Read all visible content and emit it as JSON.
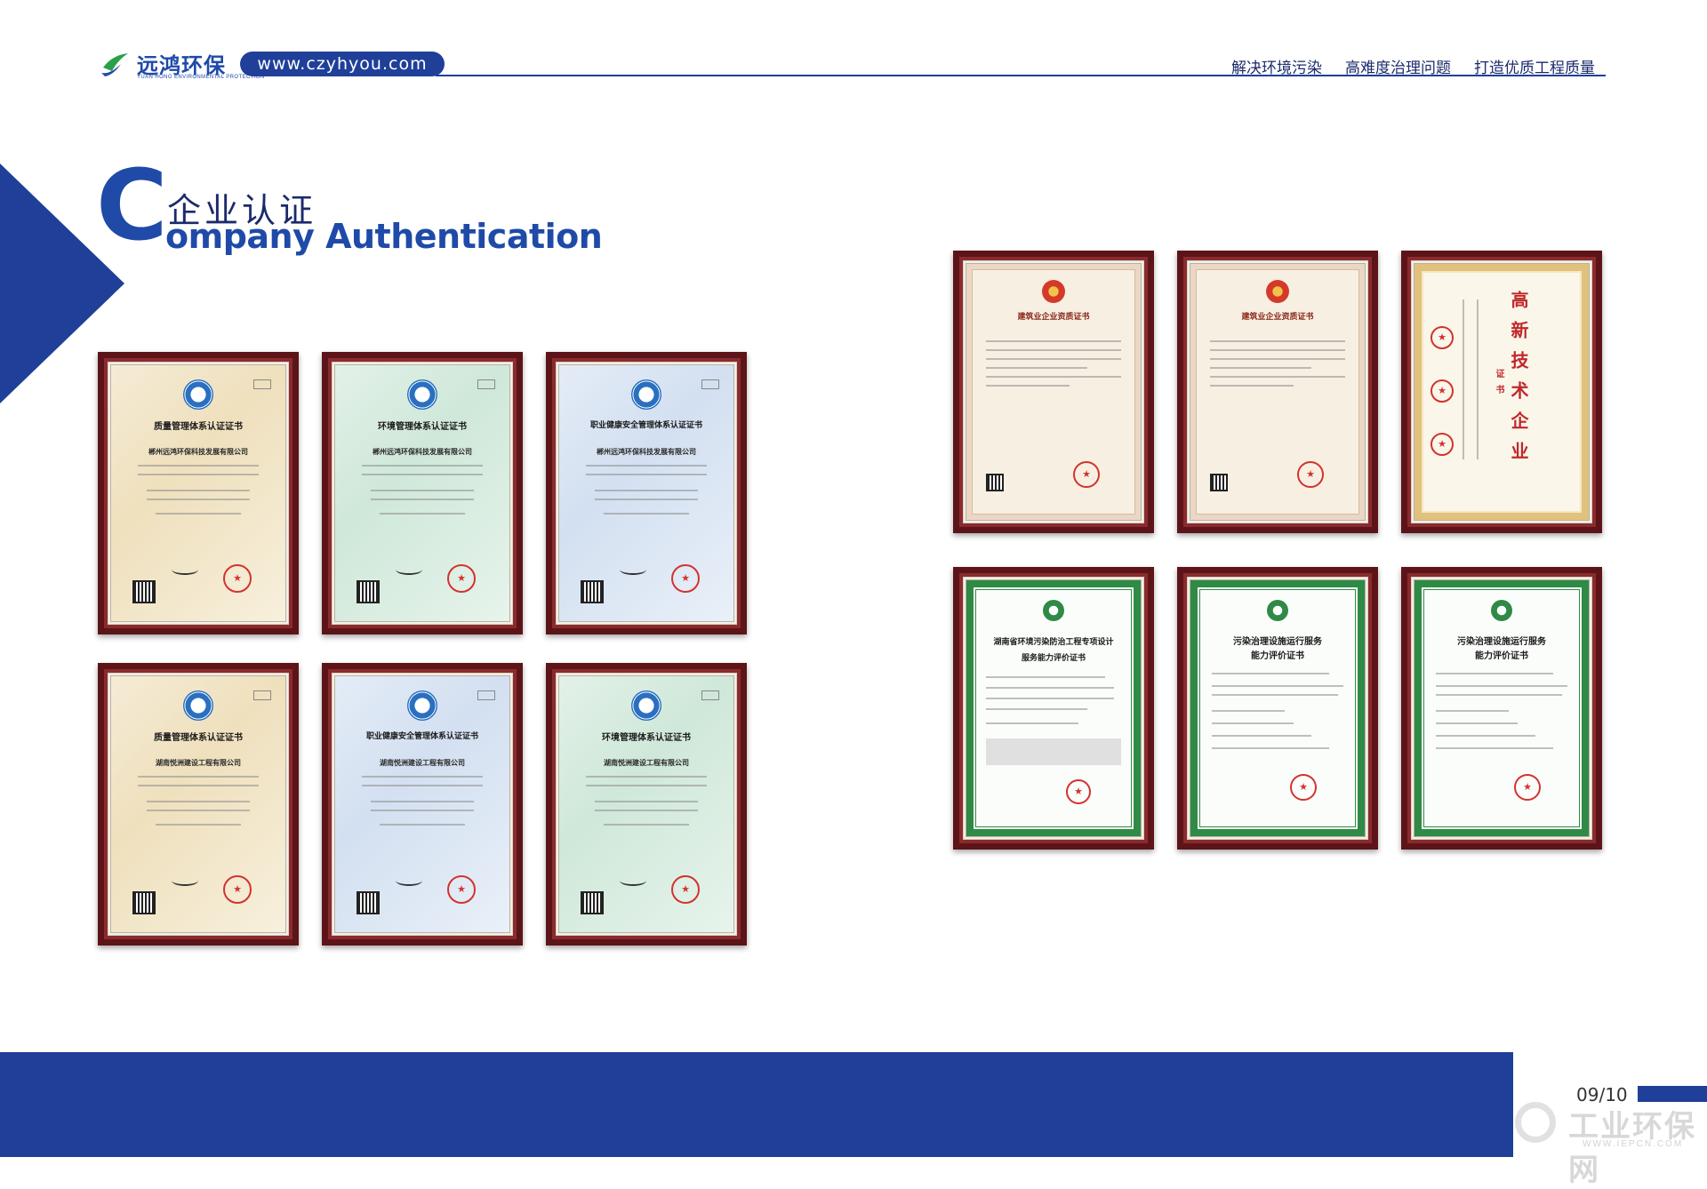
{
  "header": {
    "logo": {
      "cn": "远鸿环保",
      "en": "YUAN HONG ENVIRONMENTAL PROTECTION"
    },
    "url": "www.czyhyou.com",
    "slogans": [
      "解决环境污染",
      "高难度治理问题",
      "打造优质工程质量"
    ]
  },
  "section": {
    "initial": "C",
    "title_cn": "企业认证",
    "title_en": "ompany Authentication"
  },
  "certificates": {
    "iso_row1": [
      {
        "title": "质量管理体系认证证书",
        "company": "郴州远鸿环保科技发展有限公司"
      },
      {
        "title": "环境管理体系认证证书",
        "company": "郴州远鸿环保科技发展有限公司"
      },
      {
        "title": "职业健康安全管理体系认证证书",
        "company": "郴州远鸿环保科技发展有限公司"
      }
    ],
    "iso_row2": [
      {
        "title": "质量管理体系认证证书",
        "company": "湖南悦洲建设工程有限公司"
      },
      {
        "title": "职业健康安全管理体系认证证书",
        "company": "湖南悦洲建设工程有限公司"
      },
      {
        "title": "环境管理体系认证证书",
        "company": "湖南悦洲建设工程有限公司"
      }
    ],
    "qualification": [
      {
        "title": "建筑业企业资质证书"
      },
      {
        "title": "建筑业企业资质证书"
      }
    ],
    "hightech": {
      "title": "高新技术企业",
      "subtitle": "证书"
    },
    "green": [
      {
        "title_line1": "湖南省环境污染防治工程专项设计",
        "title_line2": "服务能力评价证书"
      },
      {
        "title_line1": "污染治理设施运行服务",
        "title_line2": "能力评价证书"
      },
      {
        "title_line1": "污染治理设施运行服务",
        "title_line2": "能力评价证书"
      }
    ]
  },
  "footer": {
    "page": "09/10",
    "watermark_cn": "工业环保网",
    "watermark_en": "WWW.IEPCN.COM"
  },
  "colors": {
    "brand_blue": "#1f3f98",
    "frame_maroon": "#5d1418",
    "seal_red": "#d2332e",
    "cert_green": "#2f8a46"
  }
}
